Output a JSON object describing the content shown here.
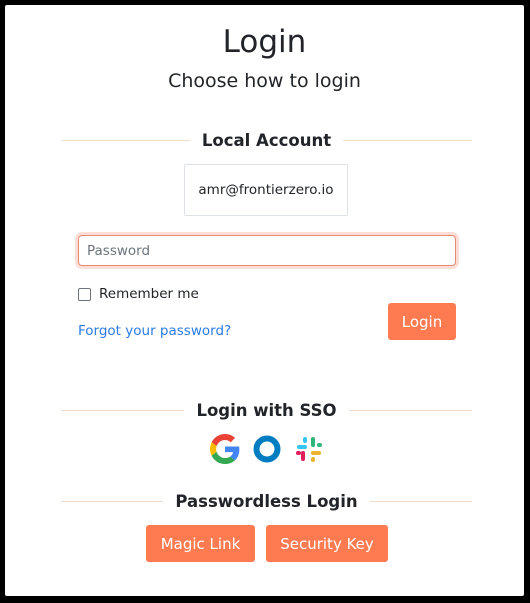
{
  "header": {
    "title": "Login",
    "subtitle": "Choose how to login"
  },
  "local_account": {
    "section_label": "Local Account",
    "email": "amr@frontierzero.io",
    "password_placeholder": "Password",
    "remember_label": "Remember me",
    "remember_checked": false,
    "forgot_link": "Forgot your password?",
    "login_button": "Login"
  },
  "sso": {
    "section_label": "Login with SSO",
    "providers": [
      {
        "name": "Google",
        "icon": "google-icon"
      },
      {
        "name": "Okta",
        "icon": "okta-icon"
      },
      {
        "name": "Slack",
        "icon": "slack-icon"
      }
    ]
  },
  "passwordless": {
    "section_label": "Passwordless Login",
    "magic_link_button": "Magic Link",
    "security_key_button": "Security Key"
  },
  "colors": {
    "accent": "#fe7b52",
    "link": "#2a7be4",
    "divider": "#f3dcc6",
    "focus_border": "#e58a72"
  }
}
